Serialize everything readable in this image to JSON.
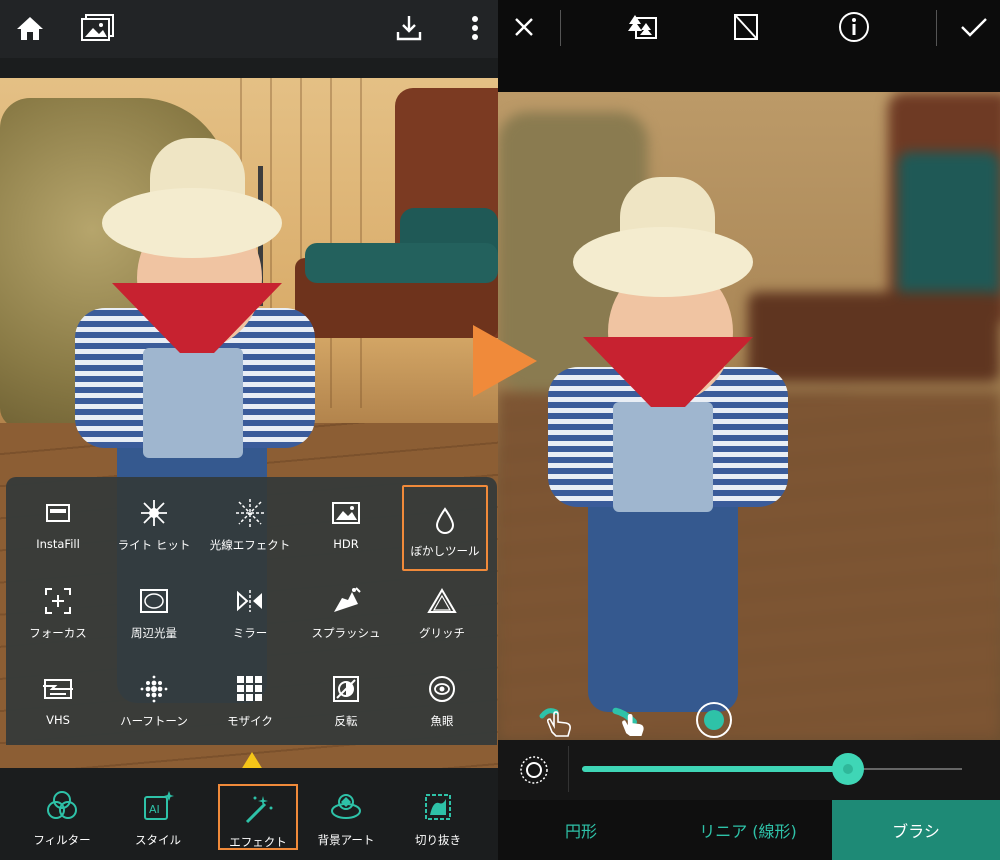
{
  "left": {
    "topbar": {
      "icons": [
        "home-icon",
        "gallery-icon",
        "download-icon",
        "more-icon"
      ]
    },
    "effects": [
      {
        "label": "InstaFill",
        "icon": "instafill-icon"
      },
      {
        "label": "ライト ヒット",
        "icon": "light-hit-icon"
      },
      {
        "label": "光線エフェクト",
        "icon": "light-rays-icon"
      },
      {
        "label": "HDR",
        "icon": "hdr-icon"
      },
      {
        "label": "ぼかしツール",
        "icon": "blur-tool-icon",
        "selected": true
      },
      {
        "label": "フォーカス",
        "icon": "focus-icon"
      },
      {
        "label": "周辺光量",
        "icon": "vignette-icon"
      },
      {
        "label": "ミラー",
        "icon": "mirror-icon"
      },
      {
        "label": "スプラッシュ",
        "icon": "splash-icon"
      },
      {
        "label": "グリッチ",
        "icon": "glitch-icon"
      },
      {
        "label": "VHS",
        "icon": "vhs-icon"
      },
      {
        "label": "ハーフトーン",
        "icon": "halftone-icon"
      },
      {
        "label": "モザイク",
        "icon": "mosaic-icon"
      },
      {
        "label": "反転",
        "icon": "invert-icon"
      },
      {
        "label": "魚眼",
        "icon": "fisheye-icon"
      }
    ],
    "tabs": [
      {
        "label": "フィルター",
        "icon": "filter-icon"
      },
      {
        "label": "スタイル",
        "icon": "ai-style-icon"
      },
      {
        "label": "エフェクト",
        "icon": "effect-wand-icon",
        "selected": true
      },
      {
        "label": "背景アート",
        "icon": "background-art-icon"
      },
      {
        "label": "切り抜き",
        "icon": "cutout-icon"
      }
    ]
  },
  "right": {
    "topbar": {
      "icons": [
        "close-icon",
        "tree-swap-icon",
        "eraser-icon",
        "info-icon",
        "check-icon"
      ]
    },
    "slider": {
      "value_fraction": 0.7
    },
    "modes": [
      {
        "label": "円形"
      },
      {
        "label": "リニア (線形)"
      },
      {
        "label": "ブラシ",
        "active": true
      }
    ]
  },
  "colors": {
    "accent": "#2ec2a8",
    "highlight": "#f08a3a",
    "pointer": "#f5c518"
  }
}
